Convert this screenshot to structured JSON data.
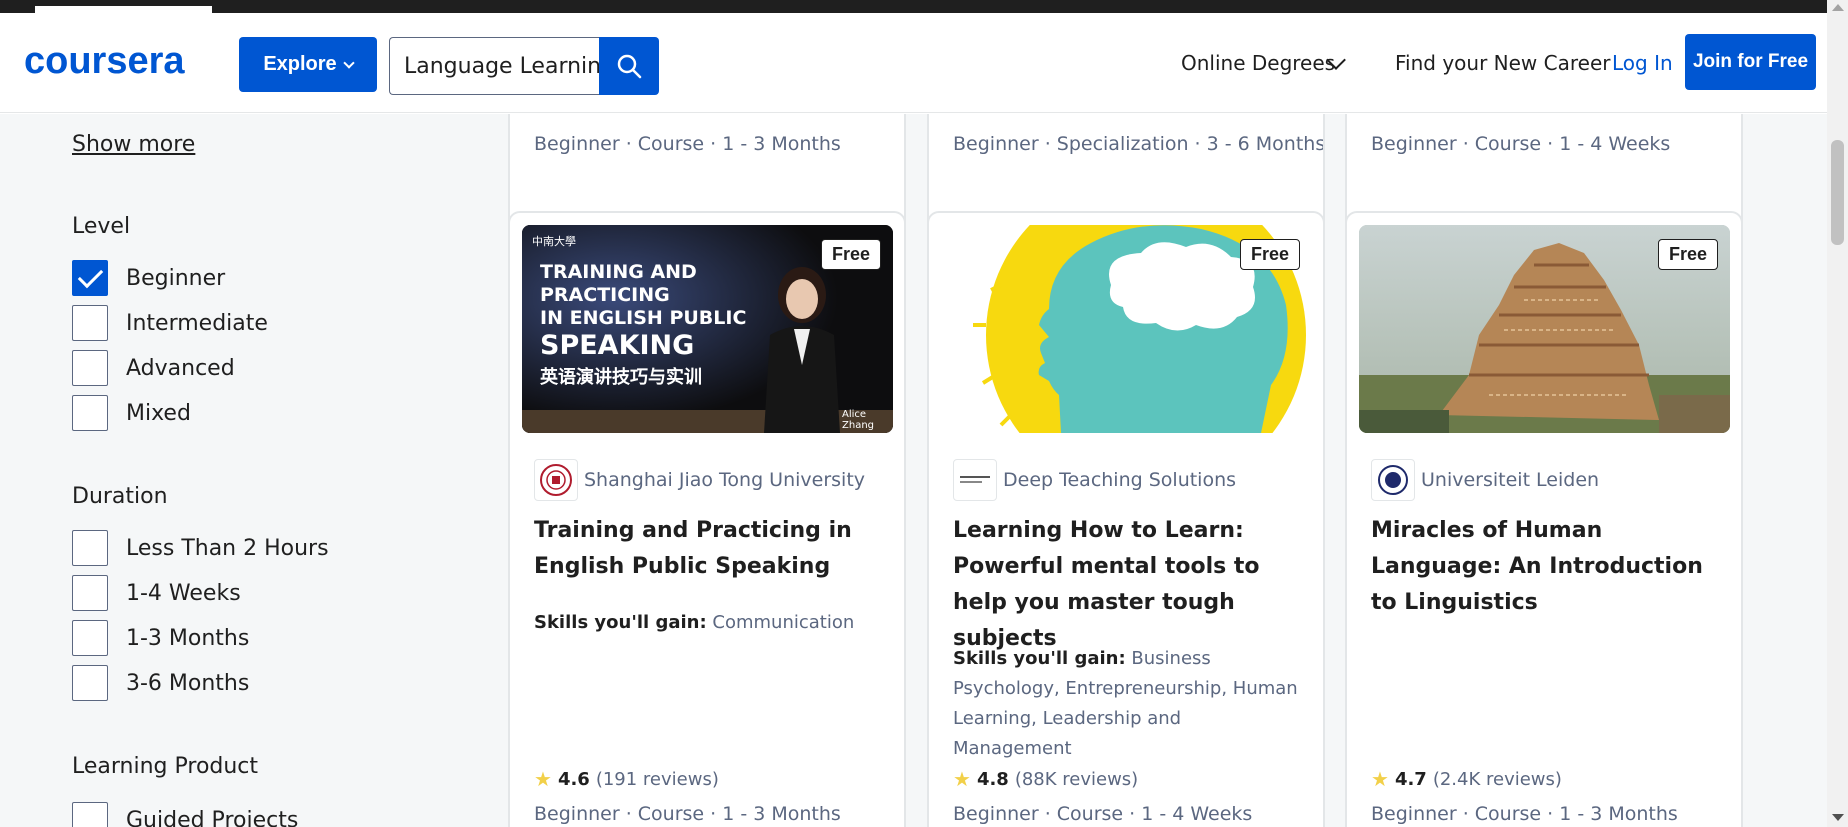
{
  "header": {
    "logo": "coursera",
    "explore_label": "Explore",
    "search_value": "Language Learnin",
    "online_degrees": "Online Degrees",
    "find_career": "Find your New Career",
    "login": "Log In",
    "join": "Join for Free"
  },
  "filters": {
    "show_more": "Show more",
    "level": {
      "title": "Level",
      "options": [
        {
          "label": "Beginner",
          "checked": true
        },
        {
          "label": "Intermediate",
          "checked": false
        },
        {
          "label": "Advanced",
          "checked": false
        },
        {
          "label": "Mixed",
          "checked": false
        }
      ]
    },
    "duration": {
      "title": "Duration",
      "options": [
        {
          "label": "Less Than 2 Hours",
          "checked": false
        },
        {
          "label": "1-4 Weeks",
          "checked": false
        },
        {
          "label": "1-3 Months",
          "checked": false
        },
        {
          "label": "3-6 Months",
          "checked": false
        }
      ]
    },
    "learning_product": {
      "title": "Learning Product",
      "options": [
        {
          "label": "Guided Projects",
          "checked": false
        }
      ]
    }
  },
  "top_cards": [
    {
      "meta": "Beginner · Course · 1 - 3 Months"
    },
    {
      "meta": "Beginner · Specialization · 3 - 6 Months"
    },
    {
      "meta": "Beginner · Course · 1 - 4 Weeks"
    }
  ],
  "cards": [
    {
      "badge": "Free",
      "image_title_lines": [
        "TRAINING AND",
        "PRACTICING",
        "IN ENGLISH PUBLIC",
        "SPEAKING"
      ],
      "image_subtitle": "英语演讲技巧与实训",
      "image_school": "中南大學",
      "image_caption": "Alice Zhang",
      "partner": "Shanghai Jiao Tong University",
      "title": "Training and Practicing in English Public Speaking",
      "skills_label": "Skills you'll gain:",
      "skills": "Communication",
      "rating": "4.6",
      "reviews": "(191 reviews)",
      "meta": "Beginner · Course · 1 - 3 Months"
    },
    {
      "badge": "Free",
      "partner": "Deep Teaching Solutions",
      "title": "Learning How to Learn: Powerful mental tools to help you master tough subjects",
      "skills_label": "Skills you'll gain:",
      "skills": "Business Psychology, Entrepreneurship, Human Learning, Leadership and Management",
      "rating": "4.8",
      "reviews": "(88K reviews)",
      "meta": "Beginner · Course · 1 - 4 Weeks"
    },
    {
      "badge": "Free",
      "partner": "Universiteit Leiden",
      "title": "Miracles of Human Language: An Introduction to Linguistics",
      "rating": "4.7",
      "reviews": "(2.4K reviews)",
      "meta": "Beginner · Course · 1 - 3 Months"
    }
  ],
  "colors": {
    "brand": "#0056d2",
    "text": "#1f1f1f",
    "muted": "#5b6780",
    "background": "#f5f7f8",
    "star": "#f2d049"
  }
}
